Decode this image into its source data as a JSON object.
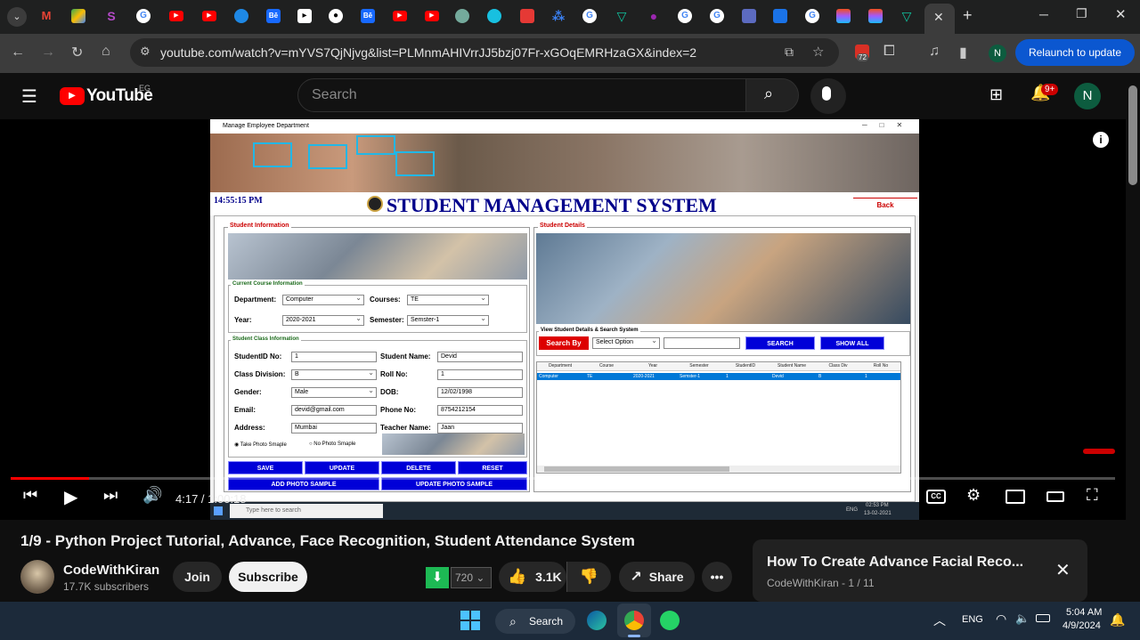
{
  "browser": {
    "url": "youtube.com/watch?v=mYVS7QjNjvg&list=PLMnmAHIVrrJJ5bzj07Fr-xGOqEMRHzaGX&index=2",
    "relaunch_label": "Relaunch to update",
    "profile_initial": "N",
    "extension_badge": "72",
    "new_tab_symbol": "+"
  },
  "youtube": {
    "logo_text": "YouTube",
    "region_code": "EG",
    "search_placeholder": "Search",
    "notification_count": "9+",
    "profile_initial": "N"
  },
  "sms_app": {
    "window_title": "Manage Employee Department",
    "clock": "14:55:15 PM",
    "title": "STUDENT MANAGEMENT SYSTEM",
    "back_label": "Back",
    "student_info_title": "Student Information",
    "course_info_title": "Current Course Information",
    "department_label": "Department:",
    "department_value": "Computer",
    "courses_label": "Courses:",
    "courses_value": "TE",
    "year_label": "Year:",
    "year_value": "2020-2021",
    "semester_label": "Semester:",
    "semester_value": "Semster-1",
    "class_info_title": "Student Class Information",
    "student_id_label": "StudentID No:",
    "student_id_value": "1",
    "student_name_label": "Student Name:",
    "student_name_value": "Devid",
    "class_div_label": "Class Division:",
    "class_div_value": "B",
    "roll_no_label": "Roll No:",
    "roll_no_value": "1",
    "gender_label": "Gender:",
    "gender_value": "Male",
    "dob_label": "DOB:",
    "dob_value": "12/02/1998",
    "email_label": "Email:",
    "email_value": "devid@gmail.com",
    "phone_label": "Phone No:",
    "phone_value": "8754212154",
    "address_label": "Address:",
    "address_value": "Mumbai",
    "teacher_label": "Teacher Name:",
    "teacher_value": "Jaan",
    "radio_take": "Take Photo Smaple",
    "radio_no": "No Photo Smaple",
    "save": "SAVE",
    "update": "UPDATE",
    "delete": "DELETE",
    "reset": "RESET",
    "add_photo": "ADD PHOTO SAMPLE",
    "update_photo": "UPDATE PHOTO SAMPLE",
    "details_title": "Student Details",
    "search_section_title": "View Student Details & Search System",
    "search_by": "Search By",
    "select_option": "Select Option",
    "search_btn": "SEARCH",
    "show_all_btn": "SHOW ALL",
    "table_headers": [
      "Department",
      "Course",
      "Year",
      "Semester",
      "StudentID",
      "Student Name",
      "Class Div",
      "Roll No"
    ],
    "table_row": [
      "Computer",
      "TE",
      "2020-2021",
      "Semster-1",
      "1",
      "Devid",
      "B",
      "1"
    ],
    "inner_taskbar_search": "Type here to search",
    "inner_time": "02:53 PM",
    "inner_date": "13-02-2021",
    "inner_lang": "ENG"
  },
  "player": {
    "timecode": "4:17 / 1:00:18",
    "progress_fraction": 0.071
  },
  "video": {
    "title": "1/9 - Python Project Tutorial, Advance, Face Recognition, Student Attendance System",
    "channel": "CodeWithKiran",
    "subscribers": "17.7K subscribers",
    "join_label": "Join",
    "subscribe_label": "Subscribe",
    "download_count": "720",
    "likes": "3.1K",
    "share_label": "Share"
  },
  "popup": {
    "title": "How To Create Advance Facial Reco...",
    "subtitle": "CodeWithKiran - 1 / 11"
  },
  "taskbar": {
    "search_label": "Search",
    "language": "ENG",
    "time": "5:04 AM",
    "date": "4/9/2024"
  },
  "colors": {
    "youtube_red": "#ff0000",
    "relaunch_blue": "#0b57d0",
    "sms_title_blue": "#00008b",
    "sms_button_blue": "#0000d8",
    "download_green": "#1db954"
  }
}
